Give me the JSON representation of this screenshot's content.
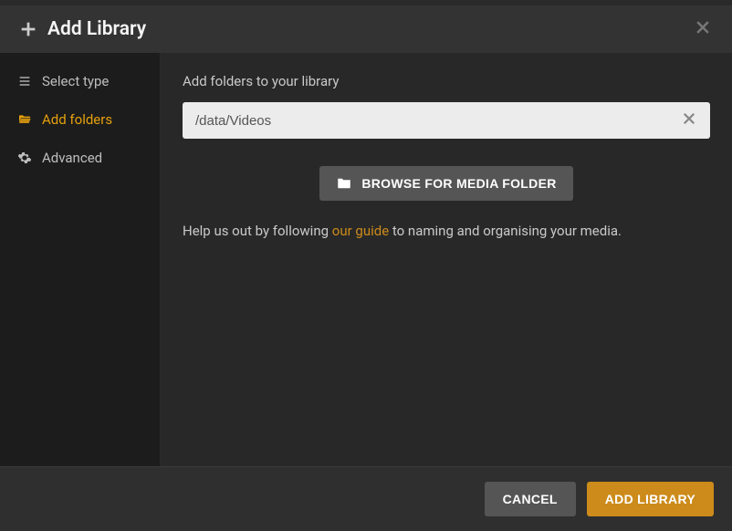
{
  "header": {
    "title": "Add Library"
  },
  "sidebar": {
    "items": [
      {
        "label": "Select type"
      },
      {
        "label": "Add folders"
      },
      {
        "label": "Advanced"
      }
    ],
    "active_index": 1
  },
  "content": {
    "prompt": "Add folders to your library",
    "path_value": "/data/Videos",
    "browse_label": "BROWSE FOR MEDIA FOLDER",
    "guide_pre": "Help us out by following ",
    "guide_link": "our guide",
    "guide_post": " to naming and organising your media."
  },
  "footer": {
    "cancel": "CANCEL",
    "add": "ADD LIBRARY"
  },
  "colors": {
    "accent": "#cc8b1a"
  }
}
